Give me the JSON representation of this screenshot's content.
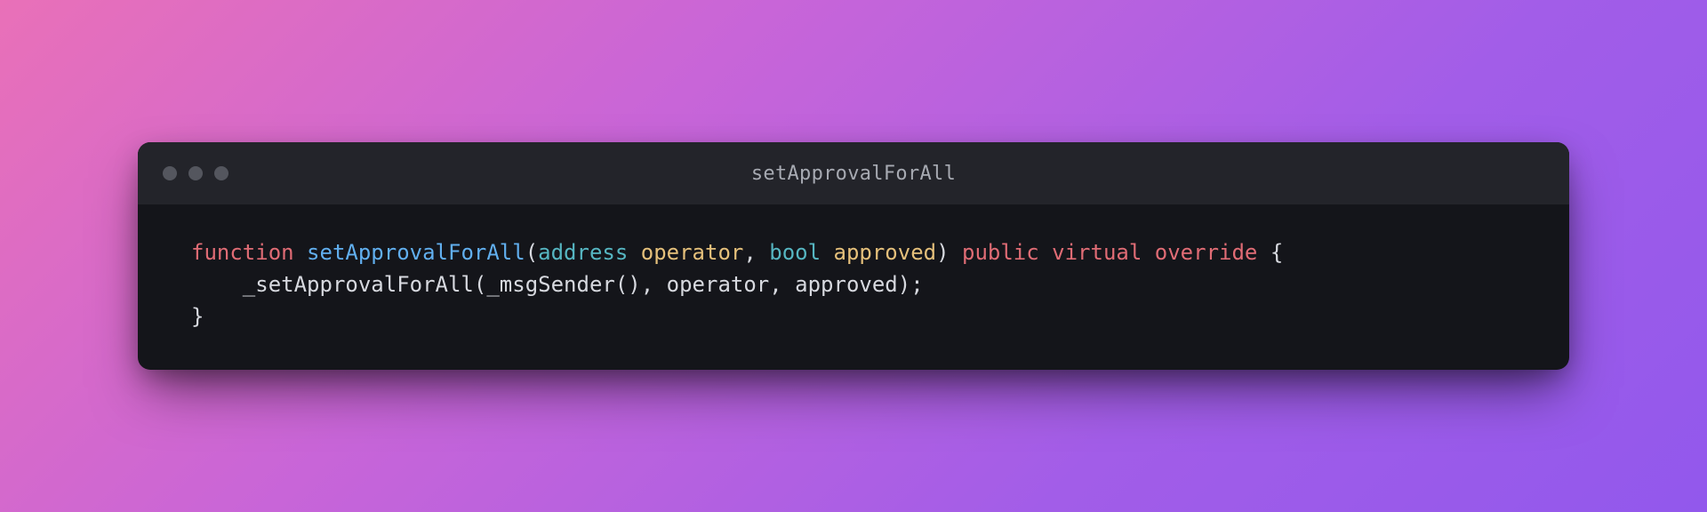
{
  "window": {
    "title": "setApprovalForAll"
  },
  "code": {
    "language": "solidity",
    "tokens": {
      "l1": {
        "kw_function": "function",
        "fn_name": "setApprovalForAll",
        "paren_open": "(",
        "type_address": "address",
        "param_operator": "operator",
        "comma1": ",",
        "type_bool": "bool",
        "param_approved": "approved",
        "paren_close": ")",
        "kw_public": "public",
        "kw_virtual": "virtual",
        "kw_override": "override",
        "brace_open": "{"
      },
      "l2": {
        "indent": "    ",
        "call_fn": "_setApprovalForAll",
        "paren_open": "(",
        "msg_sender": "_msgSender",
        "paren_pair": "()",
        "comma1": ",",
        "arg_operator": "operator",
        "comma2": ",",
        "arg_approved": "approved",
        "paren_close": ")",
        "semi": ";"
      },
      "l3": {
        "brace_close": "}"
      }
    },
    "raw": "function setApprovalForAll(address operator, bool approved) public virtual override {\n    _setApprovalForAll(_msgSender(), operator, approved);\n}"
  },
  "colors": {
    "bg_gradient_start": "#e970b8",
    "bg_gradient_end": "#9258ec",
    "window_bg": "#14151a",
    "titlebar_bg": "#23242a",
    "title_text": "#a7aab2",
    "dot": "#54565e",
    "code_default": "#d7d9df",
    "code_keyword": "#e06c75",
    "code_function": "#61afef",
    "code_type": "#56b6c2",
    "code_param": "#e5c07b"
  }
}
